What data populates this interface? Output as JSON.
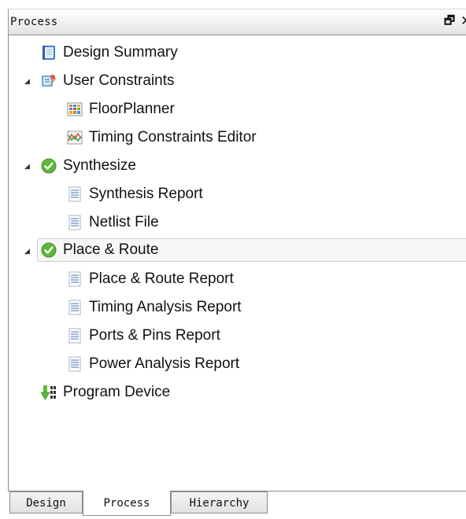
{
  "panel": {
    "title": "Process",
    "restore_glyph": "🗗",
    "close_glyph": "✕"
  },
  "tree": {
    "items": [
      {
        "label": "Design Summary",
        "icon": "design-summary-icon",
        "expandable": false
      },
      {
        "label": "User Constraints",
        "icon": "user-constraints-icon",
        "expandable": true,
        "expanded": true
      },
      {
        "label": "FloorPlanner",
        "icon": "floorplanner-icon",
        "expandable": false
      },
      {
        "label": "Timing Constraints Editor",
        "icon": "timing-constraints-icon",
        "expandable": false
      },
      {
        "label": "Synthesize",
        "icon": "check-success-icon",
        "expandable": true,
        "expanded": true
      },
      {
        "label": "Synthesis Report",
        "icon": "report-doc-icon",
        "expandable": false
      },
      {
        "label": "Netlist File",
        "icon": "report-doc-icon",
        "expandable": false
      },
      {
        "label": "Place & Route",
        "icon": "check-success-icon",
        "expandable": true,
        "expanded": true,
        "selected": true
      },
      {
        "label": "Place & Route Report",
        "icon": "report-doc-icon",
        "expandable": false
      },
      {
        "label": "Timing Analysis Report",
        "icon": "report-doc-icon",
        "expandable": false
      },
      {
        "label": "Ports & Pins Report",
        "icon": "report-doc-icon",
        "expandable": false
      },
      {
        "label": "Power Analysis Report",
        "icon": "report-doc-icon",
        "expandable": false
      },
      {
        "label": "Program Device",
        "icon": "program-device-icon",
        "expandable": false
      }
    ],
    "expander_glyph": "◢"
  },
  "tabs": [
    {
      "label": "Design",
      "active": false
    },
    {
      "label": "Process",
      "active": true
    },
    {
      "label": "Hierarchy",
      "active": false
    }
  ],
  "colors": {
    "success": "#5cb83a",
    "doc_lines": "#6f93c7",
    "selected_row": "#f7f7f7"
  }
}
